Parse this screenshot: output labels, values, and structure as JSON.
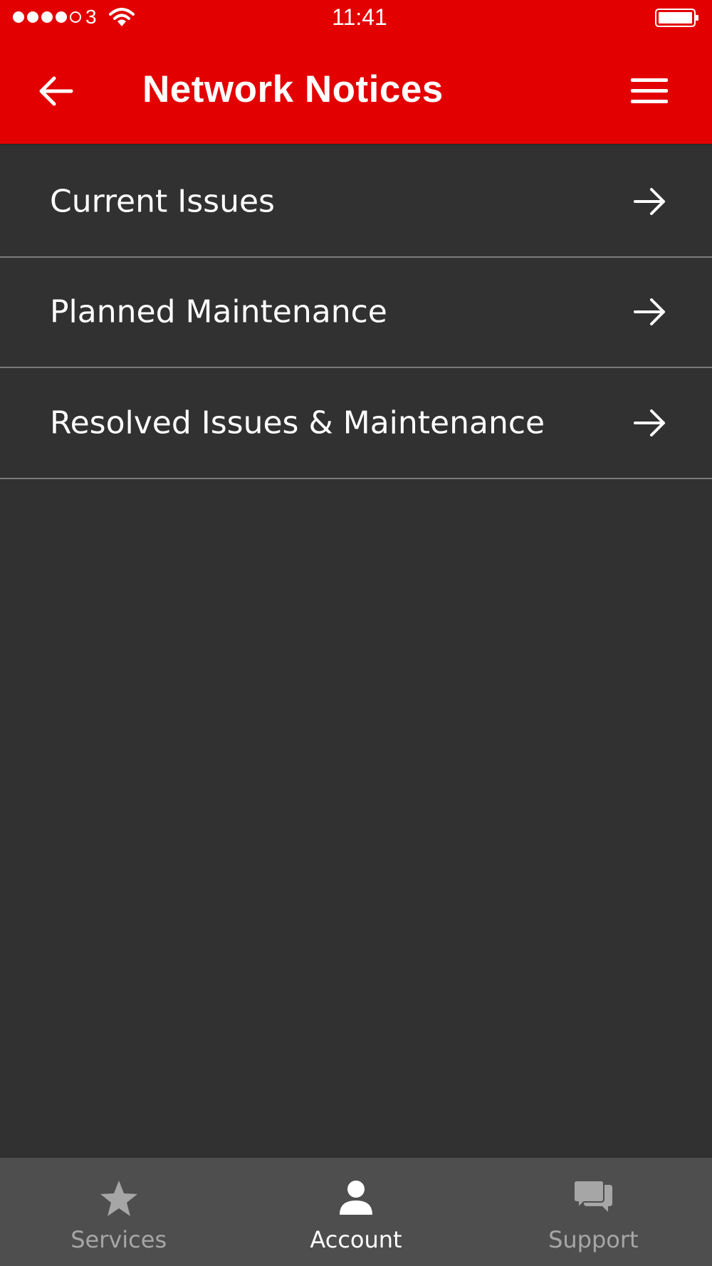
{
  "status_bar": {
    "signal_dots": [
      true,
      true,
      true,
      true,
      false
    ],
    "carrier": "3",
    "time": "11:41"
  },
  "header": {
    "title": "Network Notices",
    "back_icon": "arrow-left-icon",
    "menu_icon": "hamburger-menu-icon",
    "background_color": "#e20000"
  },
  "list": {
    "items": [
      {
        "label": "Current Issues",
        "icon": "arrow-right-icon"
      },
      {
        "label": "Planned Maintenance",
        "icon": "arrow-right-icon"
      },
      {
        "label": "Resolved Issues & Maintenance",
        "icon": "arrow-right-icon"
      }
    ]
  },
  "tabbar": {
    "tabs": [
      {
        "label": "Services",
        "icon": "star-icon",
        "active": false
      },
      {
        "label": "Account",
        "icon": "person-icon",
        "active": true
      },
      {
        "label": "Support",
        "icon": "chat-bubbles-icon",
        "active": false
      }
    ]
  }
}
